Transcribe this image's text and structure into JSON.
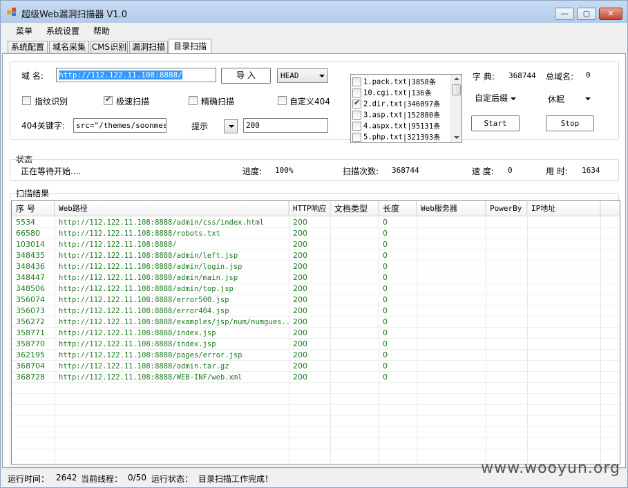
{
  "window": {
    "title": "超级Web漏洞扫描器 V1.0",
    "min": "—",
    "max": "▢",
    "close": "✕"
  },
  "menu": [
    "菜单",
    "系统设置",
    "帮助"
  ],
  "tabs": [
    "系统配置",
    "域名采集",
    "CMS识别",
    "漏洞扫描",
    "目录扫描"
  ],
  "config": {
    "domain_label": "域 名:",
    "domain_value": "http://112.122.11.108:8888/",
    "import_button": "导 入",
    "method": "HEAD",
    "fingerprint_label": "指纹识别",
    "fast_scan_label": "极速扫描",
    "precise_scan_label": "精确扫描",
    "custom404_label": "自定义404",
    "keyword_label": "404关键字:",
    "keyword_value": "src=\"/themes/soonmes/i",
    "hint_label": "提示",
    "code_value": "200",
    "dict_label": "字 典:",
    "dict_count": "368744",
    "total_label": "总域名:",
    "total_value": "0",
    "suffix_select": "自定后缀",
    "sleep_label": "休眠",
    "start_button": "Start",
    "stop_button": "Stop",
    "dict_files": [
      {
        "name": "1.pack.txt",
        "count": "|3858条",
        "checked": false
      },
      {
        "name": "10.cgi.txt",
        "count": "|136条",
        "checked": false
      },
      {
        "name": "2.dir.txt",
        "count": "|346097条",
        "checked": true
      },
      {
        "name": "3.asp.txt",
        "count": "|152880条",
        "checked": false
      },
      {
        "name": "4.aspx.txt",
        "count": "|95131条",
        "checked": false
      },
      {
        "name": "5.php.txt",
        "count": "|321393条",
        "checked": false
      }
    ]
  },
  "status": {
    "group_label": "状态",
    "message": "正在等待开始....",
    "progress_label": "进度:",
    "progress_value": "100%",
    "scan_count_label": "扫描次数:",
    "scan_count_value": "368744",
    "speed_label": "速 度:",
    "speed_value": "0",
    "time_label": "用 时:",
    "time_value": "1634"
  },
  "results": {
    "group_label": "扫描结果",
    "columns": [
      "序 号",
      "Web路径",
      "HTTP响应",
      "文档类型",
      "长度",
      "Web服务器",
      "PowerBy",
      "IP地址"
    ],
    "rows": [
      [
        "5534",
        "http://112.122.11.108:8888/admin/css/index.html",
        "200",
        "",
        "0"
      ],
      [
        "66580",
        "http://112.122.11.108:8888/robots.txt",
        "200",
        "",
        "0"
      ],
      [
        "103014",
        "http://112.122.11.108:8888/",
        "200",
        "",
        "0"
      ],
      [
        "348435",
        "http://112.122.11.108:8888/admin/left.jsp",
        "200",
        "",
        "0"
      ],
      [
        "348436",
        "http://112.122.11.108:8888/admin/login.jsp",
        "200",
        "",
        "0"
      ],
      [
        "348447",
        "http://112.122.11.108:8888/admin/main.jsp",
        "200",
        "",
        "0"
      ],
      [
        "348506",
        "http://112.122.11.108:8888/admin/top.jsp",
        "200",
        "",
        "0"
      ],
      [
        "356074",
        "http://112.122.11.108:8888/error500.jsp",
        "200",
        "",
        "0"
      ],
      [
        "356073",
        "http://112.122.11.108:8888/error404.jsp",
        "200",
        "",
        "0"
      ],
      [
        "356272",
        "http://112.122.11.108:8888/examples/jsp/num/numgues...",
        "200",
        "",
        "0"
      ],
      [
        "358771",
        "http://112.122.11.108:8888/index.jsp",
        "200",
        "",
        "0"
      ],
      [
        "358770",
        "http://112.122.11.108:8888/index.jsp",
        "200",
        "",
        "0"
      ],
      [
        "362195",
        "http://112.122.11.108:8888/pages/error.jsp",
        "200",
        "",
        "0"
      ],
      [
        "368704",
        "http://112.122.11.108:8888/admin.tar.gz",
        "200",
        "",
        "0"
      ],
      [
        "368728",
        "http://112.122.11.108:8888/WEB-INF/web.xml",
        "200",
        "",
        "0"
      ]
    ]
  },
  "statusbar": {
    "runtime_label": "运行时间：",
    "runtime_value": "2642",
    "threads_label": "当前线程：",
    "threads_value": "0/50",
    "state_label": "运行状态：",
    "state_value": "目录扫描工作完成！"
  },
  "watermark": "www.wooyun.org",
  "colors": {
    "row_text": "#1a7a1a",
    "selection": "#3399ff"
  }
}
